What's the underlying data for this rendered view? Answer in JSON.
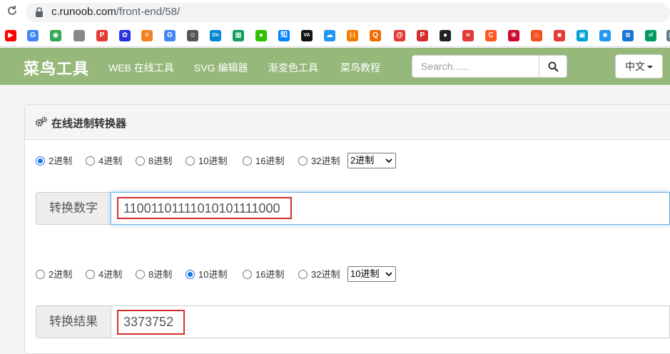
{
  "browser": {
    "url_host": "c.runoob.com",
    "url_path": "/front-end/58/"
  },
  "bookmarks": [
    {
      "icon": "youtube-icon",
      "color": "#ff0000",
      "glyph": "▶"
    },
    {
      "icon": "google-translate-icon",
      "color": "#4285f4",
      "glyph": "G"
    },
    {
      "icon": "chrome-icon",
      "color": "#34a853",
      "glyph": "◉"
    },
    {
      "icon": "apple-icon",
      "color": "#888888",
      "glyph": ""
    },
    {
      "icon": "p-icon",
      "color": "#e53935",
      "glyph": "P"
    },
    {
      "icon": "baidu-icon",
      "color": "#2932e1",
      "glyph": "✿"
    },
    {
      "icon": "stackoverflow-icon",
      "color": "#f48024",
      "glyph": "≡"
    },
    {
      "icon": "google-icon",
      "color": "#4285f4",
      "glyph": "G"
    },
    {
      "icon": "smiley-icon",
      "color": "#555555",
      "glyph": "☺"
    },
    {
      "icon": "on-icon",
      "color": "#0288d1",
      "glyph": "On"
    },
    {
      "icon": "sheets-icon",
      "color": "#0f9d58",
      "glyph": "▦"
    },
    {
      "icon": "wechat-icon",
      "color": "#2dc100",
      "glyph": "●"
    },
    {
      "icon": "zhihu-icon",
      "color": "#0084ff",
      "glyph": "知"
    },
    {
      "icon": "va-icon",
      "color": "#111111",
      "glyph": "VA"
    },
    {
      "icon": "cloud-icon",
      "color": "#2196f3",
      "glyph": "☁"
    },
    {
      "icon": "bracket-icon",
      "color": "#f57c00",
      "glyph": "[-]"
    },
    {
      "icon": "q-icon",
      "color": "#ef6c00",
      "glyph": "Q"
    },
    {
      "icon": "at-icon",
      "color": "#e53935",
      "glyph": "@"
    },
    {
      "icon": "p2-icon",
      "color": "#d32f2f",
      "glyph": "P"
    },
    {
      "icon": "github-icon",
      "color": "#222222",
      "glyph": "●"
    },
    {
      "icon": "ie-icon",
      "color": "#e53935",
      "glyph": "ie"
    },
    {
      "icon": "c-icon",
      "color": "#ff5722",
      "glyph": "C"
    },
    {
      "icon": "huawei-icon",
      "color": "#cf0a2c",
      "glyph": "❀"
    },
    {
      "icon": "flame-icon",
      "color": "#f4511e",
      "glyph": "♨"
    },
    {
      "icon": "red-square-icon",
      "color": "#e53935",
      "glyph": "■"
    },
    {
      "icon": "bilibili-icon",
      "color": "#00a1d6",
      "glyph": "▣"
    },
    {
      "icon": "blue-square-icon",
      "color": "#2196f3",
      "glyph": "■"
    },
    {
      "icon": "layers-icon",
      "color": "#1976d2",
      "glyph": "≋"
    },
    {
      "icon": "sf-icon",
      "color": "#009a61",
      "glyph": "sf"
    },
    {
      "icon": "grid-icon",
      "color": "#607d8b",
      "glyph": "▦"
    }
  ],
  "site": {
    "logo": "菜鸟工具",
    "nav": [
      "WEB 在线工具",
      "SVG 编辑器",
      "渐变色工具",
      "菜鸟教程"
    ],
    "search_placeholder": "Search......",
    "lang": "中文",
    "accent": "#96b97b"
  },
  "converter": {
    "title": "在线进制转换器",
    "input_options": [
      "2进制",
      "4进制",
      "8进制",
      "10进制",
      "16进制",
      "32进制"
    ],
    "input_selected_index": 0,
    "input_select_value": "2进制",
    "input_label": "转换数字",
    "input_value": "11001101111010101111000",
    "output_options": [
      "2进制",
      "4进制",
      "8进制",
      "10进制",
      "16进制",
      "32进制"
    ],
    "output_selected_index": 3,
    "output_select_value": "10进制",
    "output_label": "转换结果",
    "output_value": "3373752",
    "highlight_color": "#d32f2f"
  }
}
